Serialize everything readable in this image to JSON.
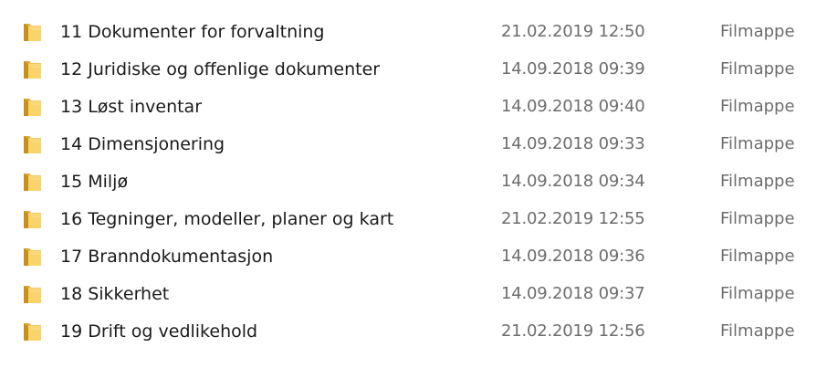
{
  "folder_icon": "folder-icon",
  "colors": {
    "folder_back": "#e0a82c",
    "folder_front": "#f8d46a",
    "name_text": "#1a1a1a",
    "meta_text": "#6d6d6d"
  },
  "files": [
    {
      "name": "11 Dokumenter for forvaltning",
      "modified": "21.02.2019 12:50",
      "type": "Filmappe"
    },
    {
      "name": "12 Juridiske og offenlige dokumenter",
      "modified": "14.09.2018 09:39",
      "type": "Filmappe"
    },
    {
      "name": "13 Løst inventar",
      "modified": "14.09.2018 09:40",
      "type": "Filmappe"
    },
    {
      "name": "14 Dimensjonering",
      "modified": "14.09.2018 09:33",
      "type": "Filmappe"
    },
    {
      "name": "15 Miljø",
      "modified": "14.09.2018 09:34",
      "type": "Filmappe"
    },
    {
      "name": "16 Tegninger, modeller, planer og kart",
      "modified": "21.02.2019 12:55",
      "type": "Filmappe"
    },
    {
      "name": "17 Branndokumentasjon",
      "modified": "14.09.2018 09:36",
      "type": "Filmappe"
    },
    {
      "name": "18 Sikkerhet",
      "modified": "14.09.2018 09:37",
      "type": "Filmappe"
    },
    {
      "name": "19 Drift og vedlikehold",
      "modified": "21.02.2019 12:56",
      "type": "Filmappe"
    }
  ]
}
